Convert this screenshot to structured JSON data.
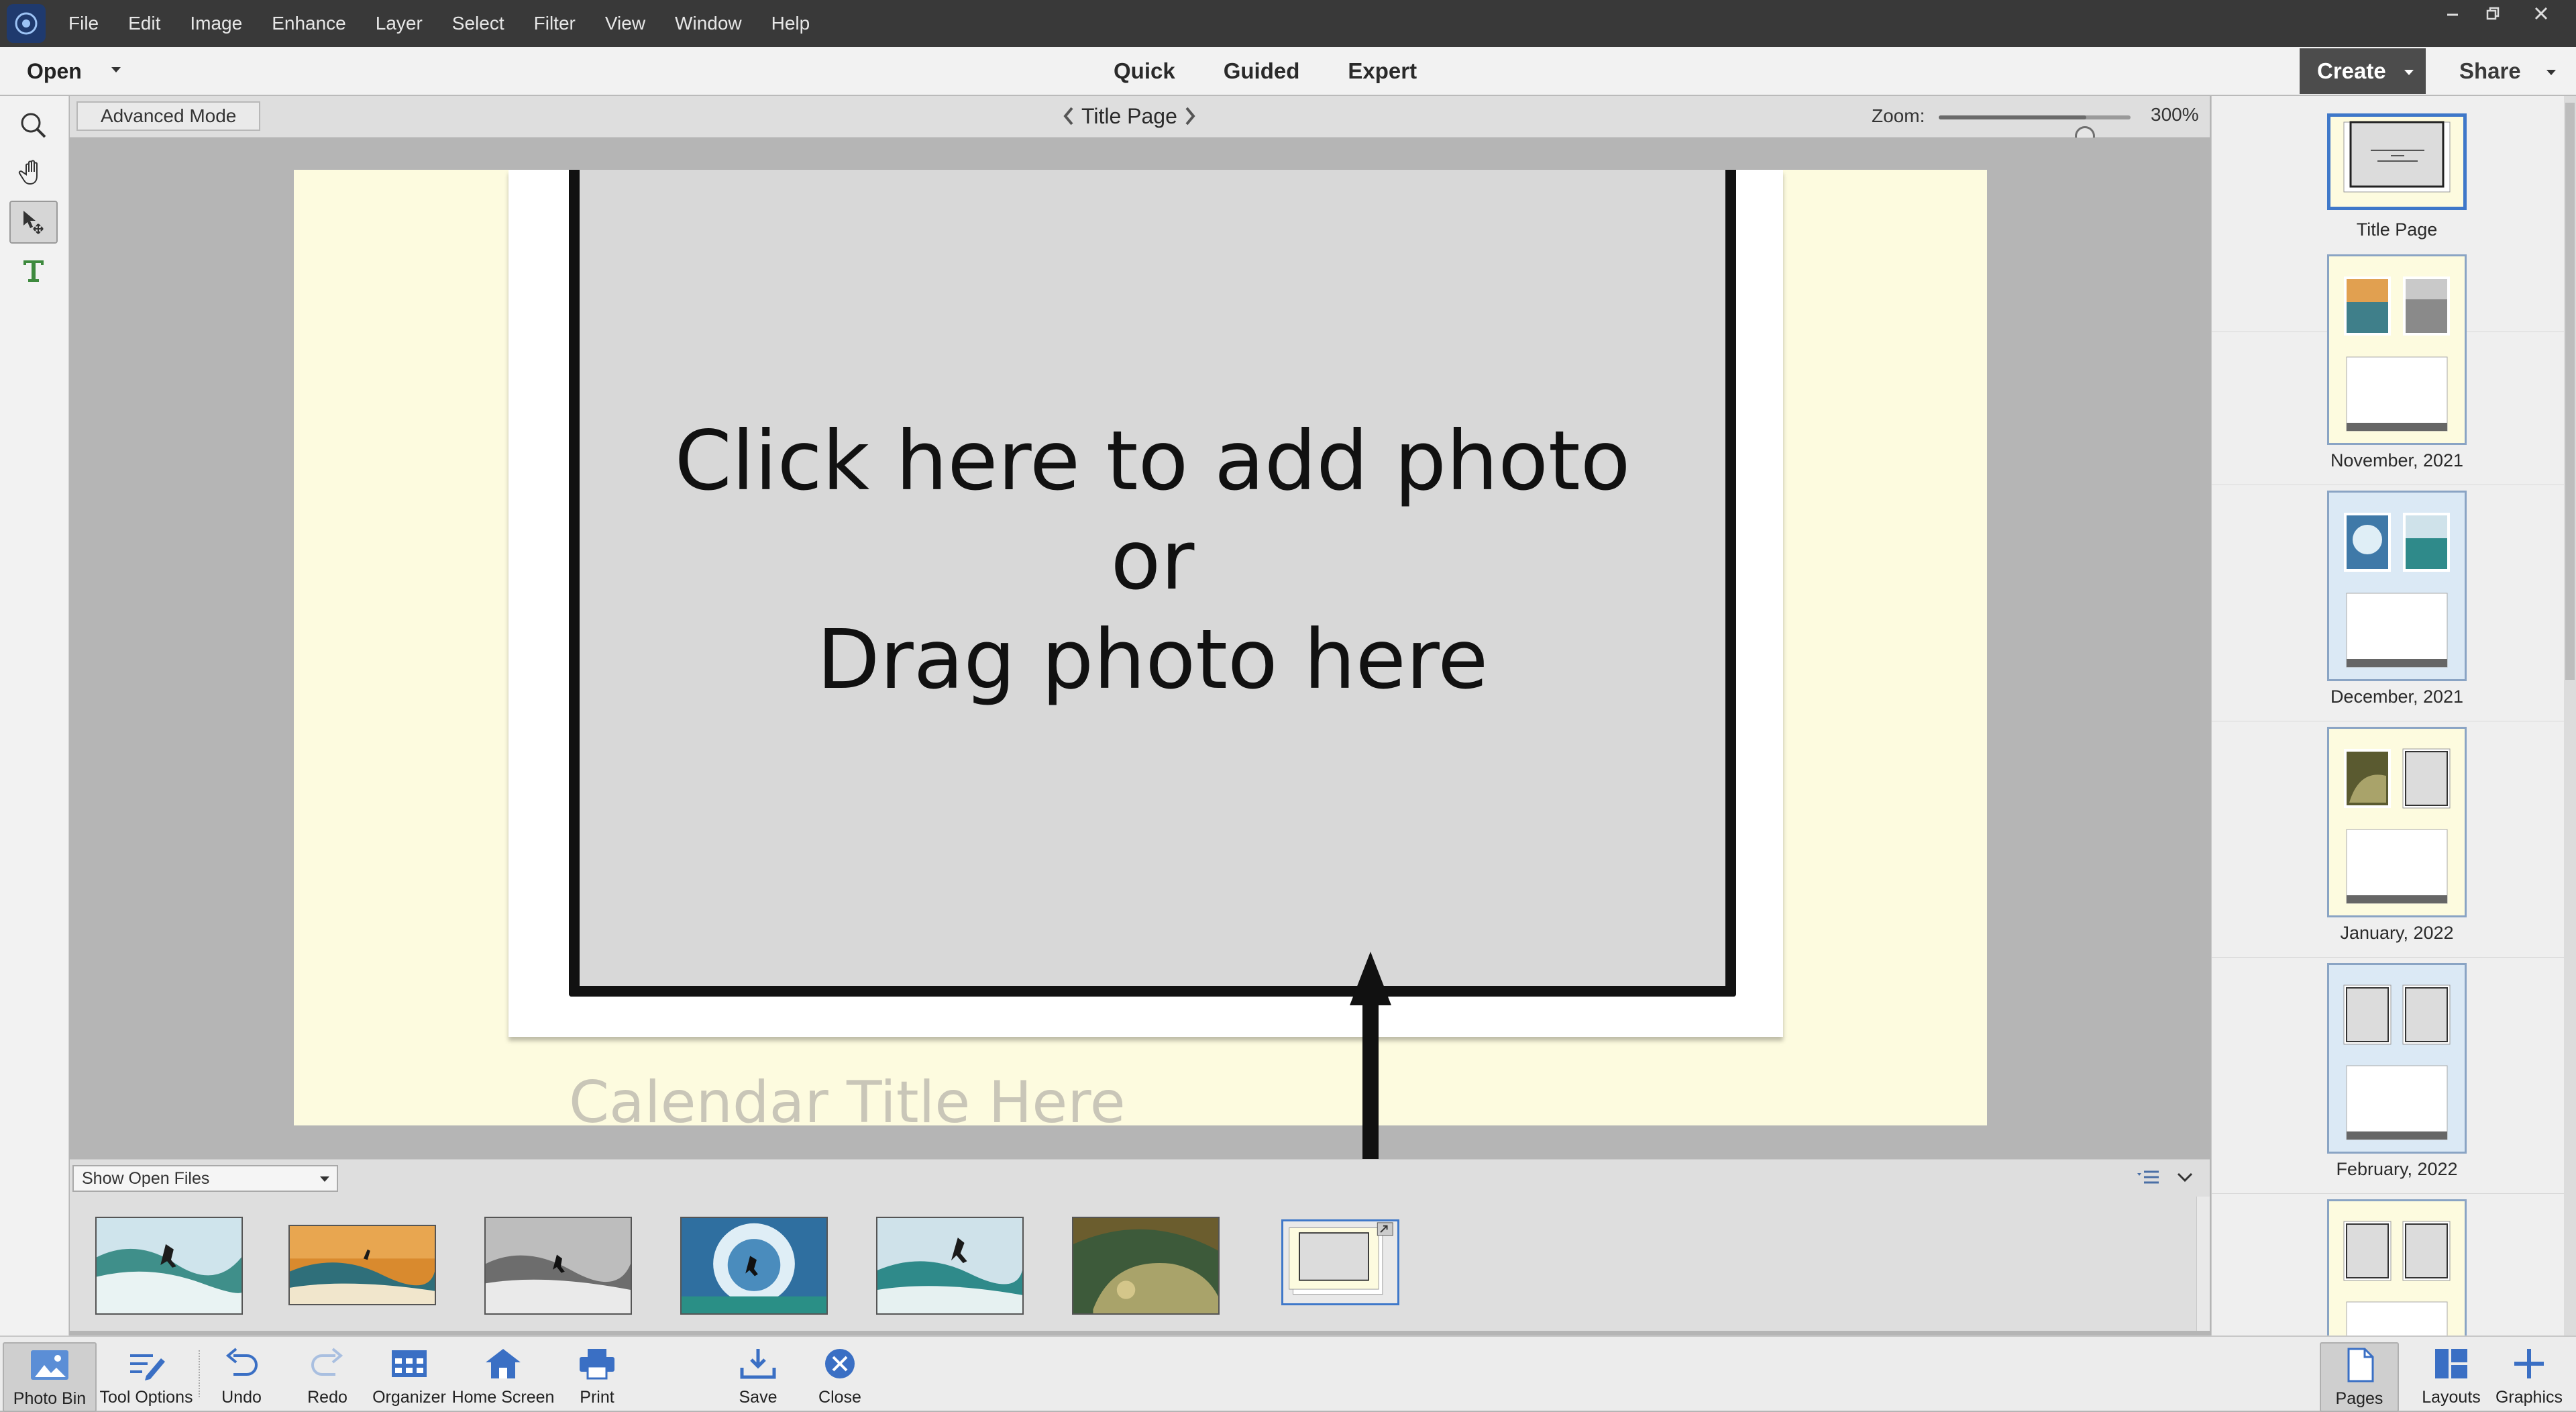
{
  "menu": {
    "items": [
      "File",
      "Edit",
      "Image",
      "Enhance",
      "Layer",
      "Select",
      "Filter",
      "View",
      "Window",
      "Help"
    ]
  },
  "modebar": {
    "open_label": "Open",
    "modes": [
      "Quick",
      "Guided",
      "Expert"
    ],
    "create_label": "Create",
    "share_label": "Share"
  },
  "options": {
    "advanced_mode_label": "Advanced Mode",
    "page_title": "Title Page",
    "zoom_label": "Zoom:",
    "zoom_value": "300%",
    "zoom_fraction": 0.77
  },
  "canvas": {
    "placeholder_line1": "Click here to add photo",
    "placeholder_line2": "or",
    "placeholder_line3": "Drag photo here",
    "calendar_title": "Calendar Title Here"
  },
  "bin": {
    "filter_label": "Show Open Files",
    "thumbnails": [
      "surfer-wave-photo",
      "kitesurfer-sunset-photo",
      "surfer-bw-photo",
      "surfer-spray-photo",
      "surfer-turn-photo",
      "wave-barrel-photo",
      "title-page-project-thumbnail"
    ]
  },
  "pages": [
    {
      "label": "Title Page"
    },
    {
      "label": "November, 2021"
    },
    {
      "label": "December, 2021"
    },
    {
      "label": "January, 2022"
    },
    {
      "label": "February, 2022"
    }
  ],
  "taskbar": {
    "left": [
      "Photo Bin",
      "Tool Options",
      "Undo",
      "Redo",
      "Organizer",
      "Home Screen",
      "Print"
    ],
    "center": [
      "Save",
      "Close"
    ],
    "right": [
      "Pages",
      "Layouts",
      "Graphics"
    ]
  },
  "colors": {
    "accent": "#3f78c9",
    "page_background": "#fdfbdf",
    "menubar": "#393939"
  }
}
